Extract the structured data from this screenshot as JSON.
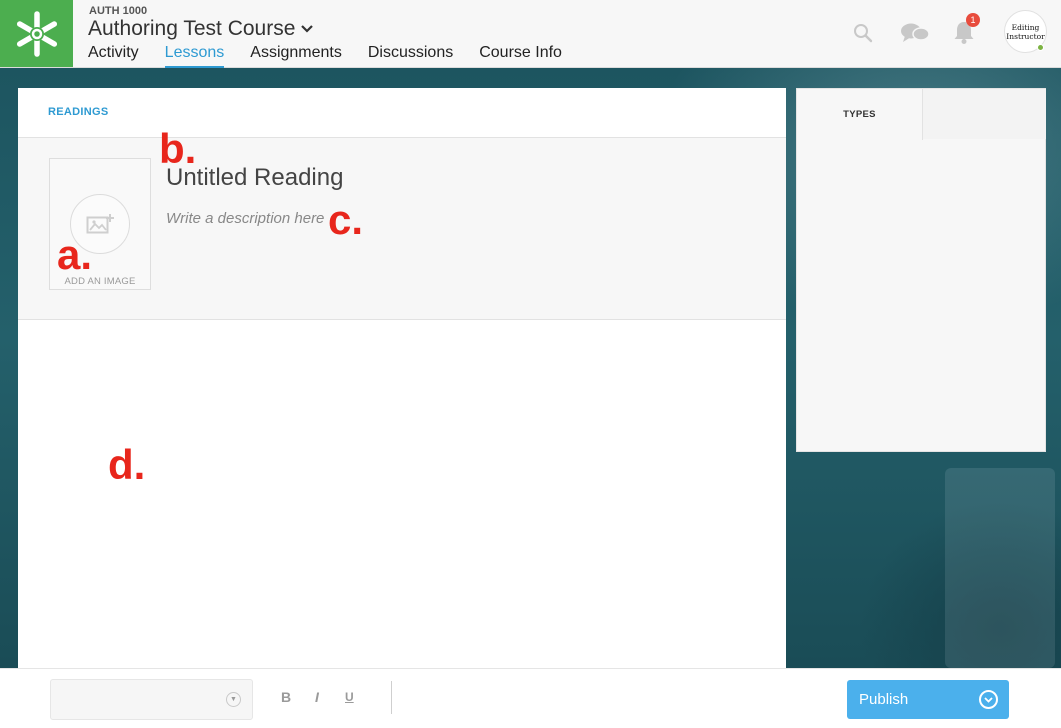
{
  "header": {
    "course_code": "AUTH 1000",
    "course_title": "Authoring Test Course",
    "nav": [
      {
        "label": "Activity"
      },
      {
        "label": "Lessons",
        "active": true
      },
      {
        "label": "Assignments"
      },
      {
        "label": "Discussions"
      },
      {
        "label": "Course Info"
      }
    ],
    "notification_count": "1",
    "avatar_line1": "Editing",
    "avatar_line2": "Instructor",
    "icons": [
      "search-icon",
      "chat-icon",
      "bell-icon"
    ]
  },
  "main": {
    "tab": "READINGS",
    "add_image_label": "ADD AN IMAGE",
    "reading_title": "Untitled Reading",
    "description_placeholder": "Write a description here"
  },
  "annotations": {
    "a": "a.",
    "b": "b.",
    "c": "c.",
    "d": "d."
  },
  "side": {
    "tab": "TYPES"
  },
  "toolbar": {
    "bold": "B",
    "italic": "I",
    "underline": "U",
    "publish_label": "Publish"
  },
  "colors": {
    "accent": "#2e9ad2",
    "logo_green": "#4cae4f",
    "publish_blue": "#4bb0ec",
    "annotation_red": "#e8261c"
  }
}
